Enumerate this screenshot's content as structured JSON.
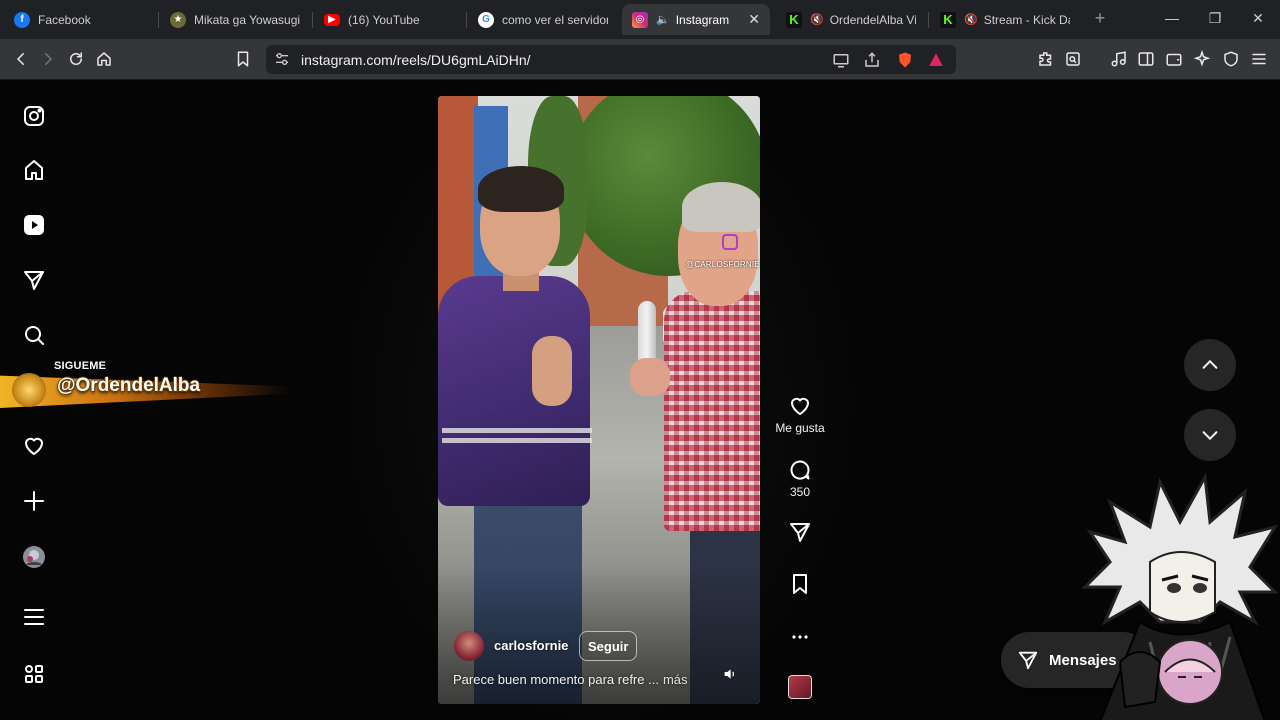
{
  "browser": {
    "tabs": [
      {
        "label": "Facebook",
        "icon": "facebook-icon",
        "color": "#1877f2",
        "muted": false,
        "active": false
      },
      {
        "label": "Mikata ga Yowasugite",
        "icon": "anime-site-icon",
        "color": "#6b6b3a",
        "muted": false,
        "active": false
      },
      {
        "label": "(16) YouTube",
        "icon": "youtube-icon",
        "color": "#ff0000",
        "muted": false,
        "active": false
      },
      {
        "label": "como ver el servidor y",
        "icon": "google-icon",
        "color": "#4285f4",
        "muted": false,
        "active": false
      },
      {
        "label": "Instagram",
        "icon": "instagram-icon",
        "color": "#d62976",
        "muted": true,
        "active": true
      },
      {
        "label": "OrdendelAlba Vid",
        "icon": "kick-icon",
        "color": "#53fc18",
        "muted": true,
        "active": false
      },
      {
        "label": "Stream - Kick Das",
        "icon": "kick-icon",
        "color": "#53fc18",
        "muted": true,
        "active": false
      }
    ],
    "new_tab": "+",
    "url": "instagram.com/reels/DU6gmLAiDHn/"
  },
  "overlay": {
    "banner_top": "SIGUEME",
    "banner_handle": "@OrdendelAlba"
  },
  "reel": {
    "watermark": "@CARLOSFORNIE",
    "owner": "carlosfornie",
    "follow_label": "Seguir",
    "caption": "Parece buen momento para refre ...",
    "more_label": "más"
  },
  "actions": {
    "like_label": "Me gusta",
    "comments_count": "350"
  },
  "messages": {
    "label": "Mensajes"
  },
  "colors": {
    "page_bg": "#050505",
    "chrome_bg": "#202124",
    "toolbar_bg": "#35363a",
    "button_bg": "#262626"
  }
}
